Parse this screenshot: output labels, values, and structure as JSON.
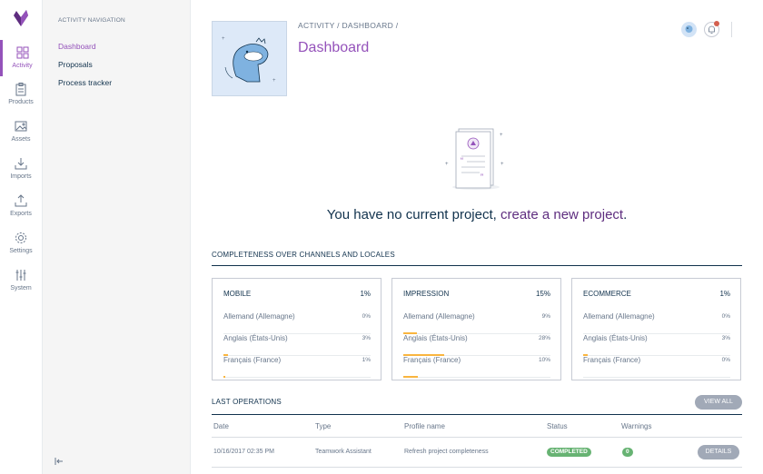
{
  "menu": {
    "items": [
      {
        "label": "Activity",
        "icon": "dashboard-icon",
        "active": true
      },
      {
        "label": "Products",
        "icon": "clipboard-icon"
      },
      {
        "label": "Assets",
        "icon": "image-icon"
      },
      {
        "label": "Imports",
        "icon": "import-icon"
      },
      {
        "label": "Exports",
        "icon": "export-icon"
      },
      {
        "label": "Settings",
        "icon": "gear-icon"
      },
      {
        "label": "System",
        "icon": "sliders-icon"
      }
    ]
  },
  "subnav": {
    "title": "Activity navigation",
    "items": [
      {
        "label": "Dashboard",
        "active": true
      },
      {
        "label": "Proposals"
      },
      {
        "label": "Process tracker"
      }
    ]
  },
  "header": {
    "breadcrumb": "ACTIVITY / DASHBOARD /",
    "title": "Dashboard"
  },
  "empty_state": {
    "text": "You have no current project, ",
    "link": "create a new project",
    "suffix": "."
  },
  "completeness": {
    "title": "Completeness over channels and locales",
    "channels": [
      {
        "name": "Mobile",
        "pct": "1%",
        "locales": [
          {
            "name": "Allemand (Allemagne)",
            "pct": "0%",
            "value": 0
          },
          {
            "name": "Anglais (États-Unis)",
            "pct": "3%",
            "value": 3
          },
          {
            "name": "Français (France)",
            "pct": "1%",
            "value": 1
          }
        ]
      },
      {
        "name": "Impression",
        "pct": "15%",
        "locales": [
          {
            "name": "Allemand (Allemagne)",
            "pct": "9%",
            "value": 9
          },
          {
            "name": "Anglais (États-Unis)",
            "pct": "28%",
            "value": 28
          },
          {
            "name": "Français (France)",
            "pct": "10%",
            "value": 10
          }
        ]
      },
      {
        "name": "Ecommerce",
        "pct": "1%",
        "locales": [
          {
            "name": "Allemand (Allemagne)",
            "pct": "0%",
            "value": 0
          },
          {
            "name": "Anglais (États-Unis)",
            "pct": "3%",
            "value": 3
          },
          {
            "name": "Français (France)",
            "pct": "0%",
            "value": 0
          }
        ]
      }
    ]
  },
  "operations": {
    "title": "Last operations",
    "view_all": "VIEW ALL",
    "columns": [
      "Date",
      "Type",
      "Profile name",
      "Status",
      "Warnings"
    ],
    "rows": [
      {
        "date": "10/16/2017 02:35 PM",
        "type": "Teamwork Assistant",
        "profile": "Refresh project completeness",
        "status": "COMPLETED",
        "warnings": "0",
        "action": "DETAILS"
      }
    ]
  },
  "colors": {
    "accent": "#9452ba",
    "progress": "#f9b53f",
    "success": "#67b373",
    "notification": "#d4604f"
  }
}
